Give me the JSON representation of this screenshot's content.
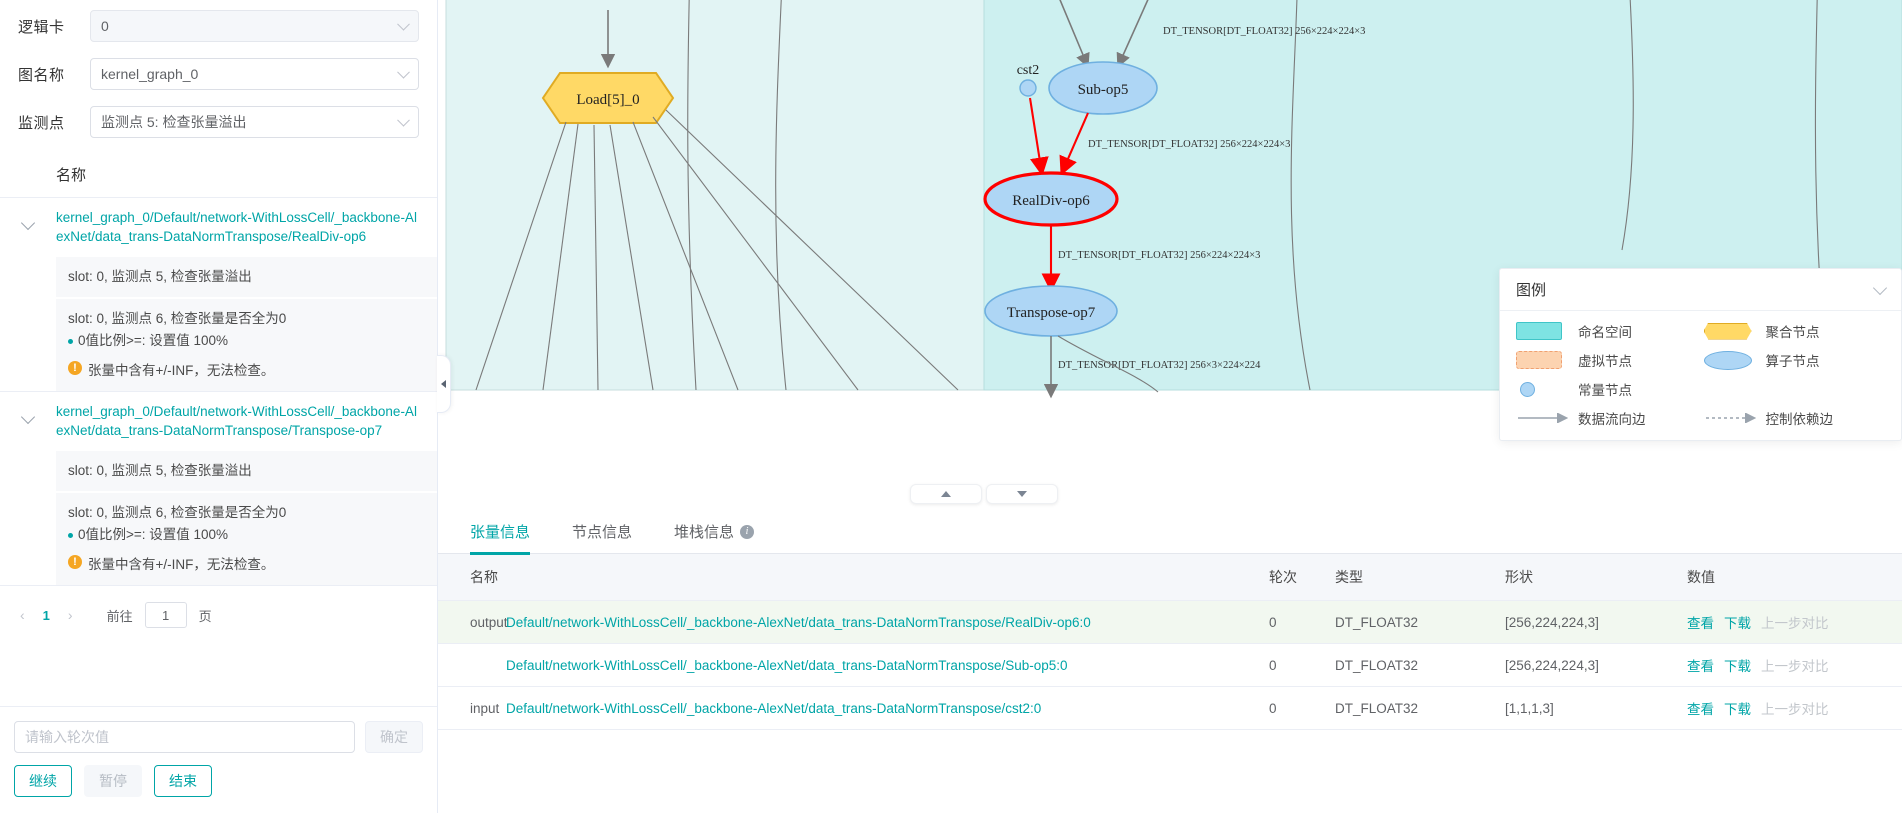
{
  "sidebar": {
    "form": [
      {
        "label": "逻辑卡",
        "value": "0",
        "name": "logic-card-select",
        "disabled": true
      },
      {
        "label": "图名称",
        "value": "kernel_graph_0",
        "name": "graph-name-select",
        "disabled": false
      },
      {
        "label": "监测点",
        "value": "监测点 5: 检查张量溢出",
        "name": "watchpoint-select",
        "disabled": false
      }
    ],
    "column_header": "名称",
    "nodes": [
      {
        "title": "kernel_graph_0/Default/network-WithLossCell/_backbone-AlexNet/data_trans-DataNormTranspose/RealDiv-op6",
        "children": [
          {
            "text": "slot: 0, 监测点 5, 检查张量溢出",
            "sub": null,
            "warn": null
          },
          {
            "text": "slot: 0, 监测点 6, 检查张量是否全为0",
            "sub": "0值比例>=: 设置值 100%",
            "warn": "张量中含有+/-INF，无法检查。"
          }
        ]
      },
      {
        "title": "kernel_graph_0/Default/network-WithLossCell/_backbone-AlexNet/data_trans-DataNormTranspose/Transpose-op7",
        "children": [
          {
            "text": "slot: 0, 监测点 5, 检查张量溢出",
            "sub": null,
            "warn": null
          },
          {
            "text": "slot: 0, 监测点 6, 检查张量是否全为0",
            "sub": "0值比例>=: 设置值 100%",
            "warn": "张量中含有+/-INF，无法检查。"
          }
        ]
      }
    ],
    "pagination": {
      "prev": "‹",
      "current_page": "1",
      "next": "›",
      "goto_label": "前往",
      "goto_value": "1",
      "page_unit": "页"
    },
    "footer": {
      "round_placeholder": "请输入轮次值",
      "round_value": "",
      "confirm": "确定",
      "continue": "继续",
      "pause": "暂停",
      "stop": "结束"
    }
  },
  "graph": {
    "nodes": [
      {
        "id": "load5",
        "label": "Load[5]_0",
        "shape": "aggregate"
      },
      {
        "id": "cst2",
        "label": "cst2",
        "shape": "const"
      },
      {
        "id": "sub5",
        "label": "Sub-op5",
        "shape": "operator"
      },
      {
        "id": "realdiv6",
        "label": "RealDiv-op6",
        "shape": "operator",
        "highlighted": true
      },
      {
        "id": "transpose7",
        "label": "Transpose-op7",
        "shape": "operator"
      }
    ],
    "edge_labels": {
      "sub_in": "DT_TENSOR[DT_FLOAT32] 256×224×224×3",
      "sub_to_realdiv": "DT_TENSOR[DT_FLOAT32] 256×224×224×3",
      "realdiv_to_transpose": "DT_TENSOR[DT_FLOAT32] 256×224×224×3",
      "transpose_out": "DT_TENSOR[DT_FLOAT32] 256×3×224×224"
    },
    "zoom_in": "zoom-in",
    "zoom_out": "zoom-out"
  },
  "legend": {
    "title": "图例",
    "items": [
      {
        "sym": "namespace",
        "label": "命名空间"
      },
      {
        "sym": "aggregate",
        "label": "聚合节点"
      },
      {
        "sym": "virtual",
        "label": "虚拟节点"
      },
      {
        "sym": "operator",
        "label": "算子节点"
      },
      {
        "sym": "const",
        "label": "常量节点"
      },
      {
        "sym": "empty",
        "label": ""
      },
      {
        "sym": "dataflow-edge",
        "label": "数据流向边"
      },
      {
        "sym": "control-edge",
        "label": "控制依赖边"
      }
    ]
  },
  "tabs": [
    {
      "label": "张量信息",
      "active": true,
      "info": false
    },
    {
      "label": "节点信息",
      "active": false,
      "info": false
    },
    {
      "label": "堆栈信息",
      "active": false,
      "info": true
    }
  ],
  "table": {
    "headers": {
      "kind": "名称",
      "name": "",
      "step": "轮次",
      "type": "类型",
      "shape": "形状",
      "value": "数值"
    },
    "actions": {
      "view": "查看",
      "download": "下载",
      "compare": "上一步对比"
    },
    "rows": [
      {
        "kind": "output",
        "name": "Default/network-WithLossCell/_backbone-AlexNet/data_trans-DataNormTranspose/RealDiv-op6:0",
        "step": "0",
        "type": "DT_FLOAT32",
        "shape": "[256,224,224,3]",
        "group": "output"
      },
      {
        "kind": "",
        "name": "Default/network-WithLossCell/_backbone-AlexNet/data_trans-DataNormTranspose/Sub-op5:0",
        "step": "0",
        "type": "DT_FLOAT32",
        "shape": "[256,224,224,3]",
        "group": "input"
      },
      {
        "kind": "input",
        "name": "Default/network-WithLossCell/_backbone-AlexNet/data_trans-DataNormTranspose/cst2:0",
        "step": "0",
        "type": "DT_FLOAT32",
        "shape": "[1,1,1,3]",
        "group": "input"
      }
    ]
  },
  "colors": {
    "accent": "#00a5a7",
    "highlight": "#ff0000",
    "op_node": "#aed6f5",
    "agg_node": "#ffd966",
    "namespace_bg": "#d9f2f2"
  }
}
